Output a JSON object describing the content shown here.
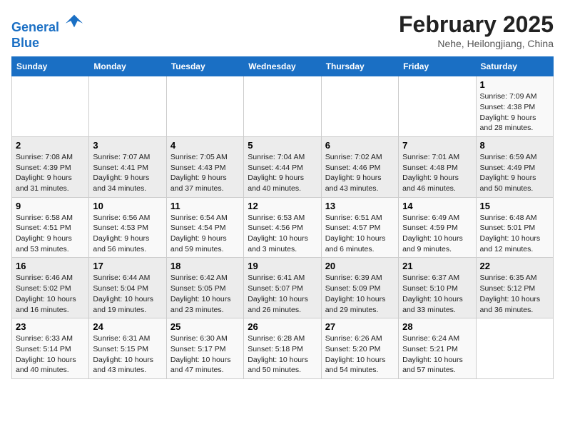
{
  "header": {
    "logo_line1": "General",
    "logo_line2": "Blue",
    "month_title": "February 2025",
    "location": "Nehe, Heilongjiang, China"
  },
  "weekdays": [
    "Sunday",
    "Monday",
    "Tuesday",
    "Wednesday",
    "Thursday",
    "Friday",
    "Saturday"
  ],
  "weeks": [
    [
      {
        "day": "",
        "info": ""
      },
      {
        "day": "",
        "info": ""
      },
      {
        "day": "",
        "info": ""
      },
      {
        "day": "",
        "info": ""
      },
      {
        "day": "",
        "info": ""
      },
      {
        "day": "",
        "info": ""
      },
      {
        "day": "1",
        "info": "Sunrise: 7:09 AM\nSunset: 4:38 PM\nDaylight: 9 hours\nand 28 minutes."
      }
    ],
    [
      {
        "day": "2",
        "info": "Sunrise: 7:08 AM\nSunset: 4:39 PM\nDaylight: 9 hours\nand 31 minutes."
      },
      {
        "day": "3",
        "info": "Sunrise: 7:07 AM\nSunset: 4:41 PM\nDaylight: 9 hours\nand 34 minutes."
      },
      {
        "day": "4",
        "info": "Sunrise: 7:05 AM\nSunset: 4:43 PM\nDaylight: 9 hours\nand 37 minutes."
      },
      {
        "day": "5",
        "info": "Sunrise: 7:04 AM\nSunset: 4:44 PM\nDaylight: 9 hours\nand 40 minutes."
      },
      {
        "day": "6",
        "info": "Sunrise: 7:02 AM\nSunset: 4:46 PM\nDaylight: 9 hours\nand 43 minutes."
      },
      {
        "day": "7",
        "info": "Sunrise: 7:01 AM\nSunset: 4:48 PM\nDaylight: 9 hours\nand 46 minutes."
      },
      {
        "day": "8",
        "info": "Sunrise: 6:59 AM\nSunset: 4:49 PM\nDaylight: 9 hours\nand 50 minutes."
      }
    ],
    [
      {
        "day": "9",
        "info": "Sunrise: 6:58 AM\nSunset: 4:51 PM\nDaylight: 9 hours\nand 53 minutes."
      },
      {
        "day": "10",
        "info": "Sunrise: 6:56 AM\nSunset: 4:53 PM\nDaylight: 9 hours\nand 56 minutes."
      },
      {
        "day": "11",
        "info": "Sunrise: 6:54 AM\nSunset: 4:54 PM\nDaylight: 9 hours\nand 59 minutes."
      },
      {
        "day": "12",
        "info": "Sunrise: 6:53 AM\nSunset: 4:56 PM\nDaylight: 10 hours\nand 3 minutes."
      },
      {
        "day": "13",
        "info": "Sunrise: 6:51 AM\nSunset: 4:57 PM\nDaylight: 10 hours\nand 6 minutes."
      },
      {
        "day": "14",
        "info": "Sunrise: 6:49 AM\nSunset: 4:59 PM\nDaylight: 10 hours\nand 9 minutes."
      },
      {
        "day": "15",
        "info": "Sunrise: 6:48 AM\nSunset: 5:01 PM\nDaylight: 10 hours\nand 12 minutes."
      }
    ],
    [
      {
        "day": "16",
        "info": "Sunrise: 6:46 AM\nSunset: 5:02 PM\nDaylight: 10 hours\nand 16 minutes."
      },
      {
        "day": "17",
        "info": "Sunrise: 6:44 AM\nSunset: 5:04 PM\nDaylight: 10 hours\nand 19 minutes."
      },
      {
        "day": "18",
        "info": "Sunrise: 6:42 AM\nSunset: 5:05 PM\nDaylight: 10 hours\nand 23 minutes."
      },
      {
        "day": "19",
        "info": "Sunrise: 6:41 AM\nSunset: 5:07 PM\nDaylight: 10 hours\nand 26 minutes."
      },
      {
        "day": "20",
        "info": "Sunrise: 6:39 AM\nSunset: 5:09 PM\nDaylight: 10 hours\nand 29 minutes."
      },
      {
        "day": "21",
        "info": "Sunrise: 6:37 AM\nSunset: 5:10 PM\nDaylight: 10 hours\nand 33 minutes."
      },
      {
        "day": "22",
        "info": "Sunrise: 6:35 AM\nSunset: 5:12 PM\nDaylight: 10 hours\nand 36 minutes."
      }
    ],
    [
      {
        "day": "23",
        "info": "Sunrise: 6:33 AM\nSunset: 5:14 PM\nDaylight: 10 hours\nand 40 minutes."
      },
      {
        "day": "24",
        "info": "Sunrise: 6:31 AM\nSunset: 5:15 PM\nDaylight: 10 hours\nand 43 minutes."
      },
      {
        "day": "25",
        "info": "Sunrise: 6:30 AM\nSunset: 5:17 PM\nDaylight: 10 hours\nand 47 minutes."
      },
      {
        "day": "26",
        "info": "Sunrise: 6:28 AM\nSunset: 5:18 PM\nDaylight: 10 hours\nand 50 minutes."
      },
      {
        "day": "27",
        "info": "Sunrise: 6:26 AM\nSunset: 5:20 PM\nDaylight: 10 hours\nand 54 minutes."
      },
      {
        "day": "28",
        "info": "Sunrise: 6:24 AM\nSunset: 5:21 PM\nDaylight: 10 hours\nand 57 minutes."
      },
      {
        "day": "",
        "info": ""
      }
    ]
  ]
}
